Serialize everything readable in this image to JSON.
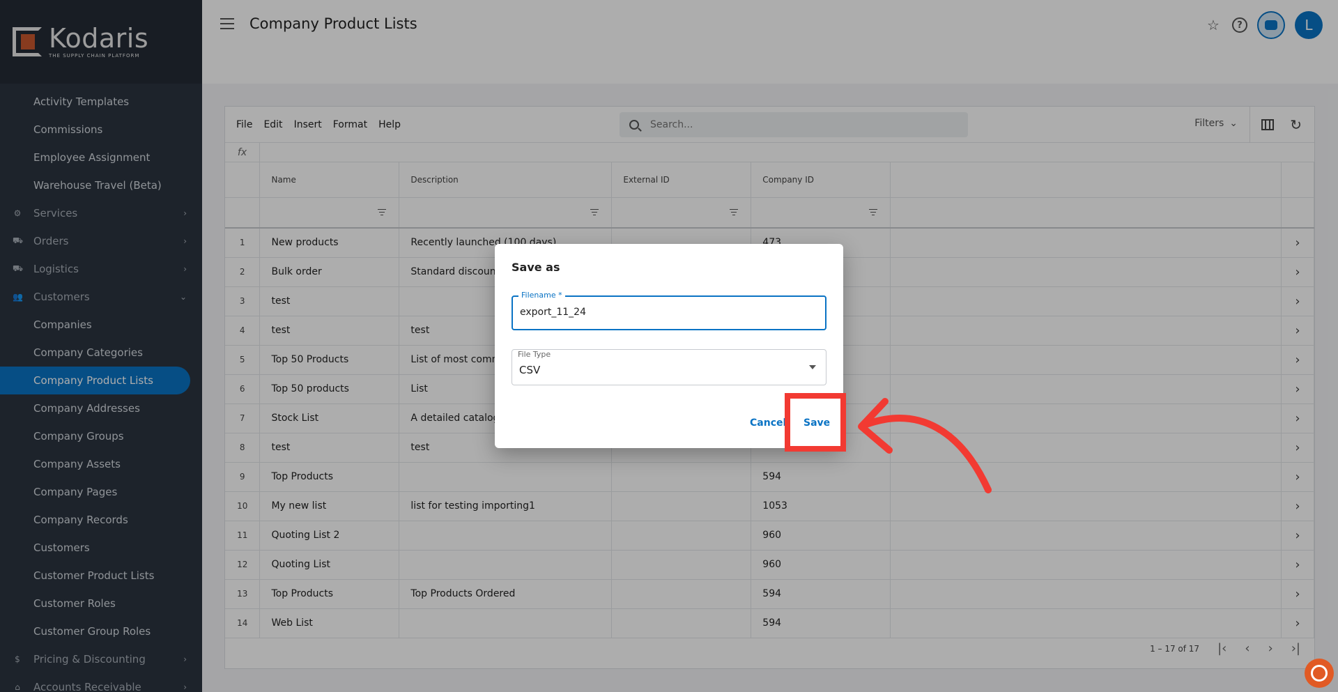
{
  "app": {
    "logo_name": "Kodaris",
    "logo_tagline": "THE SUPPLY CHAIN PLATFORM",
    "page_title": "Company Product Lists",
    "avatar_initial": "L",
    "accent_color": "#0a73c4"
  },
  "sidebar": {
    "items": [
      {
        "label": "Activity Templates",
        "kind": "sub"
      },
      {
        "label": "Commissions",
        "kind": "sub"
      },
      {
        "label": "Employee Assignment",
        "kind": "sub"
      },
      {
        "label": "Warehouse Travel (Beta)",
        "kind": "sub"
      },
      {
        "label": "Services",
        "kind": "top",
        "icon": "gears-icon",
        "chevron": "right"
      },
      {
        "label": "Orders",
        "kind": "top",
        "icon": "truck-icon",
        "chevron": "right"
      },
      {
        "label": "Logistics",
        "kind": "top",
        "icon": "delivery-icon",
        "chevron": "right"
      },
      {
        "label": "Customers",
        "kind": "top",
        "icon": "people-icon",
        "chevron": "down"
      },
      {
        "label": "Companies",
        "kind": "sub"
      },
      {
        "label": "Company Categories",
        "kind": "sub"
      },
      {
        "label": "Company Product Lists",
        "kind": "sub",
        "active": true
      },
      {
        "label": "Company Addresses",
        "kind": "sub"
      },
      {
        "label": "Company Groups",
        "kind": "sub"
      },
      {
        "label": "Company Assets",
        "kind": "sub"
      },
      {
        "label": "Company Pages",
        "kind": "sub"
      },
      {
        "label": "Company Records",
        "kind": "sub"
      },
      {
        "label": "Customers",
        "kind": "sub"
      },
      {
        "label": "Customer Product Lists",
        "kind": "sub"
      },
      {
        "label": "Customer Roles",
        "kind": "sub"
      },
      {
        "label": "Customer Group Roles",
        "kind": "sub"
      },
      {
        "label": "Pricing & Discounting",
        "kind": "top",
        "icon": "dollar-icon",
        "chevron": "right"
      },
      {
        "label": "Accounts Receivable",
        "kind": "top",
        "icon": "bank-icon",
        "chevron": "right"
      }
    ]
  },
  "toolbar": {
    "menus": [
      "File",
      "Edit",
      "Insert",
      "Format",
      "Help"
    ],
    "search_placeholder": "Search...",
    "filters_label": "Filters",
    "fx_label": "fx"
  },
  "table": {
    "columns": [
      "Name",
      "Description",
      "External ID",
      "Company ID"
    ],
    "rows": [
      {
        "n": "1",
        "name": "New products",
        "description": "Recently launched (100 days)",
        "external_id": "",
        "company_id": "473"
      },
      {
        "n": "2",
        "name": "Bulk order",
        "description": "Standard discounts",
        "external_id": "",
        "company_id": ""
      },
      {
        "n": "3",
        "name": "test",
        "description": "",
        "external_id": "",
        "company_id": ""
      },
      {
        "n": "4",
        "name": "test",
        "description": "test",
        "external_id": "",
        "company_id": ""
      },
      {
        "n": "5",
        "name": "Top 50 Products",
        "description": "List of most commo",
        "external_id": "",
        "company_id": ""
      },
      {
        "n": "6",
        "name": "Top 50 products",
        "description": "List",
        "external_id": "",
        "company_id": ""
      },
      {
        "n": "7",
        "name": "Stock List",
        "description": "A detailed catalog",
        "external_id": "",
        "company_id": ""
      },
      {
        "n": "8",
        "name": "test",
        "description": "test",
        "external_id": "",
        "company_id": ""
      },
      {
        "n": "9",
        "name": "Top Products",
        "description": "",
        "external_id": "",
        "company_id": "594"
      },
      {
        "n": "10",
        "name": "My new list",
        "description": "list for testing importing1",
        "external_id": "",
        "company_id": "1053"
      },
      {
        "n": "11",
        "name": "Quoting List 2",
        "description": "",
        "external_id": "",
        "company_id": "960"
      },
      {
        "n": "12",
        "name": "Quoting List",
        "description": "",
        "external_id": "",
        "company_id": "960"
      },
      {
        "n": "13",
        "name": "Top Products",
        "description": "Top Products Ordered",
        "external_id": "",
        "company_id": "594"
      },
      {
        "n": "14",
        "name": "Web List",
        "description": "",
        "external_id": "",
        "company_id": "594"
      }
    ]
  },
  "pagination": {
    "range_label": "1 – 17 of 17"
  },
  "dialog": {
    "title": "Save as",
    "filename_label": "Filename *",
    "filename_value": "export_11_24",
    "filetype_label": "File Type",
    "filetype_value": "CSV",
    "cancel_label": "Cancel",
    "save_label": "Save"
  },
  "annotation": {
    "highlight_color": "#f23a32"
  }
}
